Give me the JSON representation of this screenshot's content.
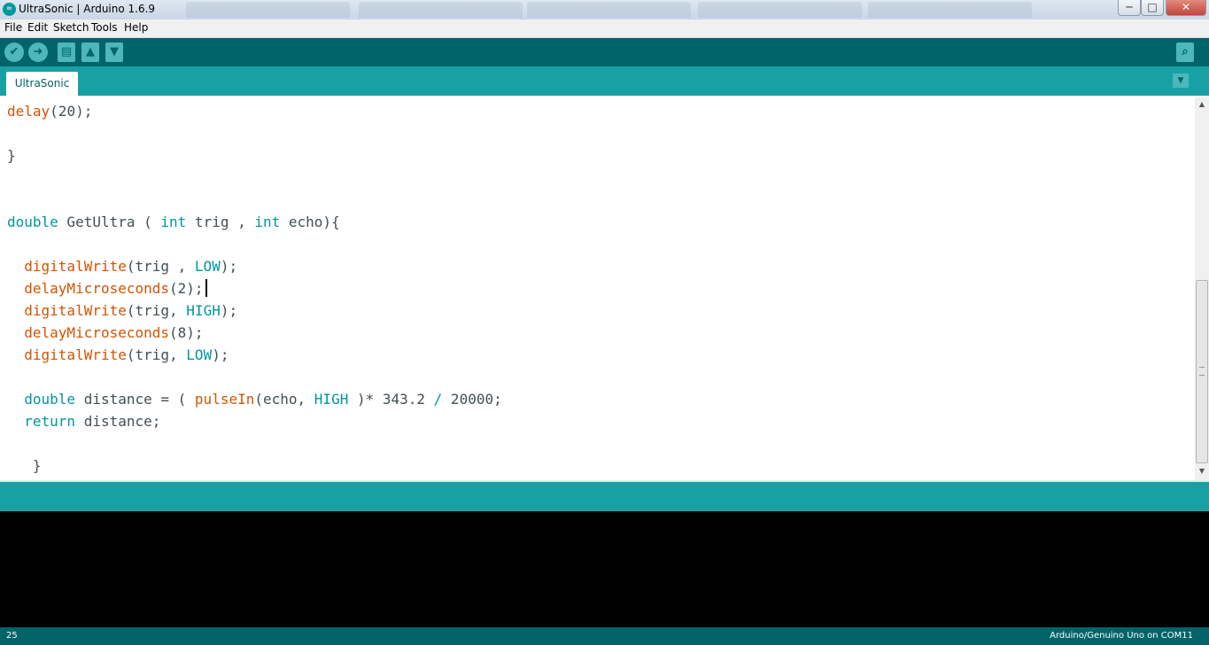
{
  "window": {
    "title": "UltraSonic | Arduino 1.6.9",
    "minimize": "─",
    "maximize": "□",
    "close": "✕"
  },
  "menu": [
    "File",
    "Edit",
    "Sketch",
    "Tools",
    "Help"
  ],
  "toolbar": {
    "verify_icon": "✔",
    "upload_icon": "➜",
    "new_icon": "▤",
    "open_icon": "▲",
    "save_icon": "▼",
    "serial_monitor_icon": "⌕"
  },
  "tabs": [
    {
      "label": "UltraSonic"
    }
  ],
  "tab_menu_icon": "▼",
  "colors": {
    "toolbar_bg": "#006468",
    "tabbar_bg": "#17a1a5",
    "keyword_type": "#00979c",
    "keyword_function": "#d35400",
    "text": "#434f54"
  },
  "code": [
    [
      {
        "t": "delay",
        "c": "fn"
      },
      {
        "t": "(20);",
        "c": ""
      }
    ],
    [],
    [
      {
        "t": "}",
        "c": ""
      }
    ],
    [],
    [],
    [
      {
        "t": "double",
        "c": "type"
      },
      {
        "t": " GetUltra ( ",
        "c": ""
      },
      {
        "t": "int",
        "c": "type"
      },
      {
        "t": " trig , ",
        "c": ""
      },
      {
        "t": "int",
        "c": "type"
      },
      {
        "t": " echo){",
        "c": ""
      }
    ],
    [],
    [
      {
        "t": "  ",
        "c": ""
      },
      {
        "t": "digitalWrite",
        "c": "fn"
      },
      {
        "t": "(trig , ",
        "c": ""
      },
      {
        "t": "LOW",
        "c": "const"
      },
      {
        "t": ");",
        "c": ""
      }
    ],
    [
      {
        "t": "  ",
        "c": ""
      },
      {
        "t": "delayMicroseconds",
        "c": "fn"
      },
      {
        "t": "(2);",
        "c": ""
      },
      {
        "t": "",
        "c": "caret"
      }
    ],
    [
      {
        "t": "  ",
        "c": ""
      },
      {
        "t": "digitalWrite",
        "c": "fn"
      },
      {
        "t": "(trig, ",
        "c": ""
      },
      {
        "t": "HIGH",
        "c": "const"
      },
      {
        "t": ");",
        "c": ""
      }
    ],
    [
      {
        "t": "  ",
        "c": ""
      },
      {
        "t": "delayMicroseconds",
        "c": "fn"
      },
      {
        "t": "(8);",
        "c": ""
      }
    ],
    [
      {
        "t": "  ",
        "c": ""
      },
      {
        "t": "digitalWrite",
        "c": "fn"
      },
      {
        "t": "(trig, ",
        "c": ""
      },
      {
        "t": "LOW",
        "c": "const"
      },
      {
        "t": ");",
        "c": ""
      }
    ],
    [],
    [
      {
        "t": "  ",
        "c": ""
      },
      {
        "t": "double",
        "c": "type"
      },
      {
        "t": " distance = ( ",
        "c": ""
      },
      {
        "t": "pulseIn",
        "c": "fn"
      },
      {
        "t": "(echo, ",
        "c": ""
      },
      {
        "t": "HIGH",
        "c": "const"
      },
      {
        "t": " )* 343.2 ",
        "c": ""
      },
      {
        "t": "/",
        "c": "type"
      },
      {
        "t": " 20000;",
        "c": ""
      }
    ],
    [
      {
        "t": "  ",
        "c": ""
      },
      {
        "t": "return",
        "c": "type"
      },
      {
        "t": " distance;",
        "c": ""
      }
    ],
    [],
    [
      {
        "t": "   }",
        "c": ""
      }
    ]
  ],
  "status": {
    "line_number": "25",
    "board": "Arduino/Genuino Uno on COM11"
  }
}
